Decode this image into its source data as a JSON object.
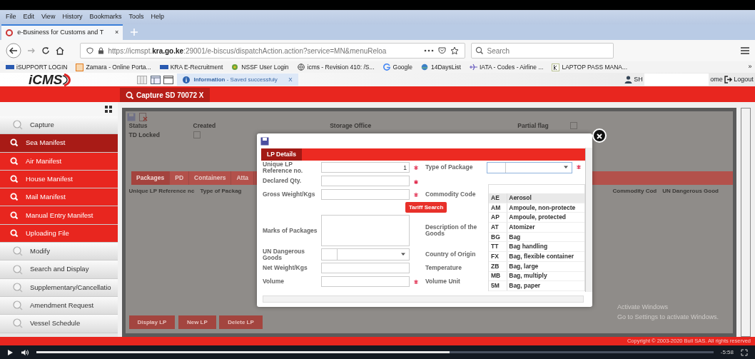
{
  "browser": {
    "menu": [
      "File",
      "Edit",
      "View",
      "History",
      "Bookmarks",
      "Tools",
      "Help"
    ],
    "tab": {
      "title": "e-Business for Customs and T",
      "close": "×"
    },
    "url": {
      "prefix": "https://icmspt.",
      "host": "kra.go.ke",
      "rest": ":29001/e-biscus/dispatchAction.action?service=MN&menuReloa"
    },
    "search": {
      "placeholder": "Search"
    },
    "bookmarks": [
      {
        "label": "iSUPPORT LOGIN",
        "kind": "sap"
      },
      {
        "label": "Zamara - Online Porta...",
        "kind": "box"
      },
      {
        "label": "KRA E-Recruitment",
        "kind": "sap"
      },
      {
        "label": "NSSF User Login",
        "kind": "leaf"
      },
      {
        "label": "icms - Revision 410: /S...",
        "kind": "globe"
      },
      {
        "label": "Google",
        "kind": "g"
      },
      {
        "label": "14DaysList",
        "kind": "disc"
      },
      {
        "label": "IATA - Codes - Airline ...",
        "kind": "plane"
      },
      {
        "label": "LAPTOP PASS MANA...",
        "kind": "k"
      }
    ],
    "overflow": "»"
  },
  "app": {
    "logo": "iCMS",
    "notice": "**Information** - Saved successfuly",
    "notice_close": "X",
    "user": "SH",
    "home": "ome",
    "logout": "Logout",
    "open_tab": "Capture SD 70072 X",
    "sidebar": [
      {
        "label": "Capture",
        "kind": "section",
        "selected": false
      },
      {
        "label": "Sea Manifest",
        "kind": "item",
        "selected": true
      },
      {
        "label": "Air Manifest",
        "kind": "item",
        "selected": false
      },
      {
        "label": "House Manifest",
        "kind": "item",
        "selected": false
      },
      {
        "label": "Mail Manifest",
        "kind": "item",
        "selected": false
      },
      {
        "label": "Manual Entry Manifest",
        "kind": "item",
        "selected": false
      },
      {
        "label": "Uploading File",
        "kind": "item",
        "selected": false
      },
      {
        "label": "Modify",
        "kind": "section",
        "selected": false
      },
      {
        "label": "Search and Display",
        "kind": "section",
        "selected": false
      },
      {
        "label": "Supplementary/Cancellatio",
        "kind": "section",
        "selected": false
      },
      {
        "label": "Amendment Request",
        "kind": "section",
        "selected": false
      },
      {
        "label": "Vessel Schedule",
        "kind": "section",
        "selected": false
      }
    ],
    "form": {
      "status_label": "Status",
      "status_value": "Created",
      "td_label": "TD Locked",
      "td_checked": false,
      "office_label": "Storage Office",
      "partial_label": "Partial flag",
      "partial_checked": false
    },
    "tabs": [
      {
        "label": "Packages",
        "selected": true
      },
      {
        "label": "PD",
        "selected": false
      },
      {
        "label": "Containers",
        "selected": false
      },
      {
        "label": "Atta",
        "selected": false
      }
    ],
    "columns": [
      "Unique LP Reference nc",
      "Type of Packag",
      "Commodity Cod",
      "UN Dangerous Good"
    ],
    "buttons": [
      "Display LP",
      "New LP",
      "Delete LP"
    ],
    "copyright": "Copyright © 2003-2020 Bull SAS. All rights reserved"
  },
  "dialog": {
    "tab": "LP Details",
    "left": [
      {
        "label": "Unique LP Reference no.",
        "kind": "input",
        "value": "1",
        "required": true
      },
      {
        "label": "Declared Qty.",
        "kind": "input",
        "required": true
      },
      {
        "label": "Gross Weight/Kgs",
        "kind": "input",
        "required": true
      },
      {
        "label": "Marks of Packages",
        "kind": "textarea",
        "required": false
      },
      {
        "label": "UN Dangerous Goods",
        "kind": "select",
        "required": false
      },
      {
        "label": "Net Weight/Kgs",
        "kind": "input",
        "required": false
      },
      {
        "label": "Volume",
        "kind": "input",
        "required": true
      }
    ],
    "right": [
      {
        "label": "Type of Package",
        "required": true
      },
      {
        "label": "Commodity Code",
        "required": false
      },
      {
        "label": "Description of the Goods",
        "required": false
      },
      {
        "label": "Country of Origin",
        "required": false
      },
      {
        "label": "Temperature",
        "required": false
      },
      {
        "label": "Volume Unit",
        "required": false
      }
    ],
    "tariff_button": "Tariff Search",
    "options": [
      {
        "code": "AE",
        "name": "Aerosol",
        "selected": true
      },
      {
        "code": "AM",
        "name": "Ampoule, non-protecte",
        "selected": false
      },
      {
        "code": "AP",
        "name": "Ampoule, protected",
        "selected": false
      },
      {
        "code": "AT",
        "name": "Atomizer",
        "selected": false
      },
      {
        "code": "BG",
        "name": "Bag",
        "selected": false
      },
      {
        "code": "TT",
        "name": "Bag handling",
        "selected": false
      },
      {
        "code": "FX",
        "name": "Bag, flexible container",
        "selected": false
      },
      {
        "code": "ZB",
        "name": "Bag, large",
        "selected": false
      },
      {
        "code": "MB",
        "name": "Bag, multiply",
        "selected": false
      },
      {
        "code": "5M",
        "name": "Bag, paper",
        "selected": false
      }
    ]
  },
  "os": {
    "watermark_title": "Activate Windows",
    "watermark_text": "Go to Settings to activate Windows."
  },
  "player": {
    "time": "-5:58",
    "progress": {
      "level": 0.61
    }
  }
}
